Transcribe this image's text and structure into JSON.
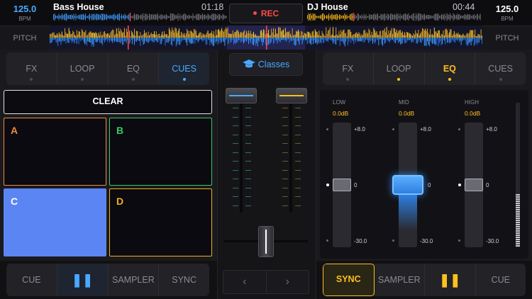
{
  "left_deck": {
    "bpm": "125.0",
    "bpm_unit": "BPM",
    "pitch_label": "PITCH",
    "title": "Bass House",
    "time": "01:18",
    "tabs": [
      "FX",
      "LOOP",
      "EQ",
      "CUES"
    ],
    "active_tab": "CUES",
    "clear_label": "CLEAR",
    "pads": [
      "A",
      "B",
      "C",
      "D"
    ],
    "transport": {
      "cue": "CUE",
      "play": "❚❚",
      "sampler": "SAMPLER",
      "sync": "SYNC"
    }
  },
  "right_deck": {
    "bpm": "125.0",
    "bpm_unit": "BPM",
    "pitch_label": "PITCH",
    "title": "DJ House",
    "time": "00:44",
    "tabs": [
      "FX",
      "LOOP",
      "EQ",
      "CUES"
    ],
    "active_tab": "EQ",
    "eq": {
      "bands": [
        {
          "label": "LOW",
          "db": "0.0dB",
          "level": 0.5
        },
        {
          "label": "MID",
          "db": "0.0dB",
          "level": 0.5
        },
        {
          "label": "HIGH",
          "db": "0.0dB",
          "level": 0.5
        }
      ],
      "max_mark": "+8.0",
      "zero_mark": "0",
      "min_mark": "-30.0",
      "meter_level": 0.37
    },
    "transport": {
      "sync": "SYNC",
      "sampler": "SAMPLER",
      "play": "❚❚",
      "cue": "CUE"
    }
  },
  "center": {
    "rec_label": "REC",
    "classes_label": "Classes",
    "nav_prev": "‹",
    "nav_next": "›"
  },
  "colors": {
    "left_accent": "#4aa8ff",
    "right_accent": "#ffc01e",
    "rec": "#ff4a4a",
    "pad_a": "#f08a3a",
    "pad_b": "#3ac864",
    "pad_c": "#5b85f2",
    "pad_d": "#f0b020"
  }
}
